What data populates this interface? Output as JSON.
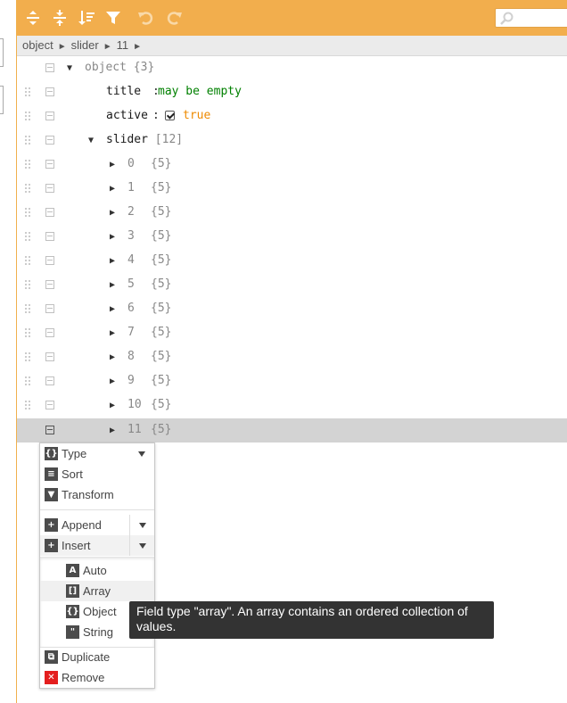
{
  "toolbar": {
    "buttons": [
      {
        "name": "expand-all-icon"
      },
      {
        "name": "collapse-all-icon"
      },
      {
        "name": "sort-icon"
      },
      {
        "name": "filter-icon"
      },
      {
        "name": "undo-icon"
      },
      {
        "name": "redo-icon"
      }
    ],
    "search_placeholder": ""
  },
  "breadcrumb": [
    "object",
    "slider",
    "11"
  ],
  "tree": {
    "root": {
      "field": "object",
      "count": "{3}"
    },
    "title": {
      "field": "title",
      "value": "may be empty"
    },
    "active": {
      "field": "active",
      "value": "true",
      "checked": true
    },
    "slider": {
      "field": "slider",
      "count": "[12]"
    },
    "items": [
      {
        "index": "0",
        "count": "{5}"
      },
      {
        "index": "1",
        "count": "{5}"
      },
      {
        "index": "2",
        "count": "{5}"
      },
      {
        "index": "3",
        "count": "{5}"
      },
      {
        "index": "4",
        "count": "{5}"
      },
      {
        "index": "5",
        "count": "{5}"
      },
      {
        "index": "6",
        "count": "{5}"
      },
      {
        "index": "7",
        "count": "{5}"
      },
      {
        "index": "8",
        "count": "{5}"
      },
      {
        "index": "9",
        "count": "{5}"
      },
      {
        "index": "10",
        "count": "{5}"
      },
      {
        "index": "11",
        "count": "{5}"
      }
    ]
  },
  "context_menu": {
    "type": "Type",
    "sort": "Sort",
    "transform": "Transform",
    "append": "Append",
    "insert": "Insert",
    "submenu": [
      {
        "label": "Auto",
        "icon": "A"
      },
      {
        "label": "Array",
        "icon": "[]"
      },
      {
        "label": "Object",
        "icon": "{}"
      },
      {
        "label": "String",
        "icon": "\""
      }
    ],
    "duplicate": "Duplicate",
    "remove": "Remove"
  },
  "tooltip": "Field type \"array\". An array contains an ordered collection of values.",
  "colors": {
    "accent": "#f2ae4d",
    "string": "#008000",
    "boolean": "#ee8a00",
    "remove": "#e41e1e"
  }
}
